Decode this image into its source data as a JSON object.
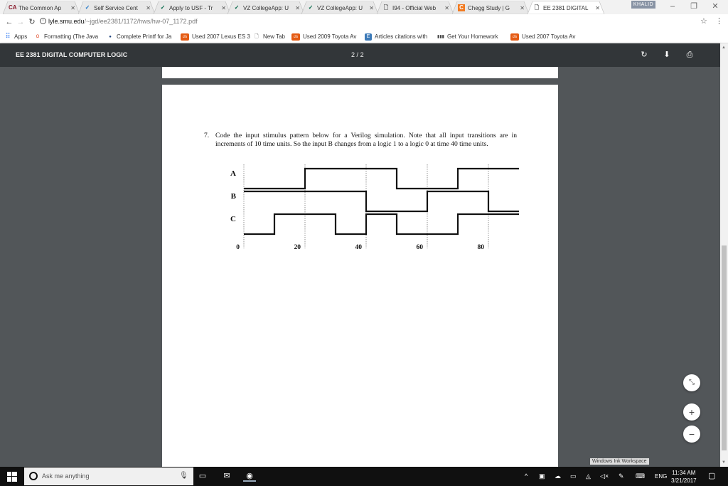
{
  "browser": {
    "tabs": [
      {
        "title": "The Common Ap",
        "favicon": "CA",
        "fav_color": "#8a1a2c",
        "active": false
      },
      {
        "title": "Self Service Cent",
        "favicon": "✓",
        "fav_color": "#1a73c8",
        "active": false
      },
      {
        "title": "Apply to USF - Tr",
        "favicon": "✓",
        "fav_color": "#006747",
        "active": false
      },
      {
        "title": "VZ CollegeApp: U",
        "favicon": "✓",
        "fav_color": "#006747",
        "active": false
      },
      {
        "title": "VZ CollegeApp: U",
        "favicon": "✓",
        "fav_color": "#006747",
        "active": false
      },
      {
        "title": "I94 - Official Web",
        "favicon": "doc",
        "fav_color": "#555555",
        "active": false
      },
      {
        "title": "Chegg Study | G",
        "favicon": "C",
        "fav_color": "#f27b21",
        "active": false
      },
      {
        "title": "EE 2381 DIGITAL",
        "favicon": "doc",
        "fav_color": "#555555",
        "active": true
      }
    ],
    "profile_name": "KHALID",
    "url_host": "lyle.smu.edu",
    "url_path": "/~jgd/ee2381/1172/hws/hw-07_1172.pdf",
    "bookmarks": [
      {
        "label": "Apps",
        "icon": "apps-grid",
        "color": "#4285f4"
      },
      {
        "label": "Formatting (The Java",
        "icon": "O",
        "color": "#e0401c"
      },
      {
        "label": "Complete Printf for Ja",
        "icon": "●",
        "color": "#1a3e7a"
      },
      {
        "label": "Used 2007 Lexus ES 3",
        "icon": "cfs",
        "color": "#e55b13"
      },
      {
        "label": "New Tab",
        "icon": "doc",
        "color": "#555555"
      },
      {
        "label": "Used 2009 Toyota Av",
        "icon": "cfs",
        "color": "#e55b13"
      },
      {
        "label": "Articles citations with",
        "icon": "E",
        "color": "#3d7ab8"
      },
      {
        "label": "Get Your Homework",
        "icon": "▮▮▮",
        "color": "#444444"
      },
      {
        "label": "Used 2007 Toyota Av",
        "icon": "cfs",
        "color": "#e55b13"
      }
    ]
  },
  "pdf": {
    "title": "EE 2381 DIGITAL COMPUTER LOGIC",
    "page_current": "2",
    "page_sep": "/",
    "page_total": "2",
    "problem_number": "7.",
    "problem_text": "Code the input stimulus pattern below for a Verilog simulation. Note that all input transitions are in increments of 10 time units. So the input B changes from a logic 1 to a logic 0 at time 40 time units.",
    "ink_workspace": "Windows Ink Workspace"
  },
  "timing": {
    "signals": [
      {
        "name": "A",
        "levels": [
          0,
          0,
          1,
          1,
          1,
          0,
          0,
          1,
          1,
          1
        ]
      },
      {
        "name": "B",
        "levels": [
          1,
          1,
          1,
          1,
          0,
          0,
          1,
          1,
          0,
          0
        ]
      },
      {
        "name": "C",
        "levels": [
          0,
          1,
          1,
          0,
          1,
          0,
          0,
          1,
          1,
          1
        ]
      }
    ],
    "time_step": 10,
    "tick_labels": [
      "0",
      "20",
      "40",
      "60",
      "80"
    ],
    "tick_times": [
      0,
      20,
      40,
      60,
      80
    ]
  },
  "taskbar": {
    "search_placeholder": "Ask me anything",
    "lang": "ENG",
    "time": "11:34 AM",
    "date": "3/21/2017"
  }
}
